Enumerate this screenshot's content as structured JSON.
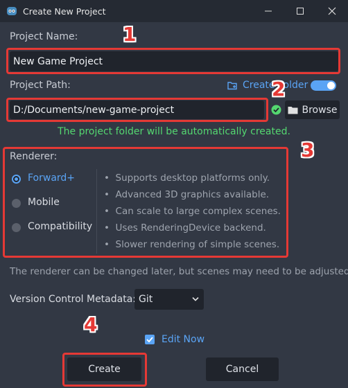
{
  "window": {
    "title": "Create New Project"
  },
  "project_name": {
    "label": "Project Name:",
    "value": "New Game Project"
  },
  "project_path": {
    "label": "Project Path:",
    "value": "D:/Documents/new-game-project",
    "create_folder_label": "Create Folder",
    "create_folder_on": true,
    "browse_label": "Browse",
    "status_message": "The project folder will be automatically created."
  },
  "renderer": {
    "label": "Renderer:",
    "options": [
      {
        "label": "Forward+",
        "selected": true
      },
      {
        "label": "Mobile",
        "selected": false
      },
      {
        "label": "Compatibility",
        "selected": false
      }
    ],
    "features": [
      "Supports desktop platforms only.",
      "Advanced 3D graphics available.",
      "Can scale to large complex scenes.",
      "Uses RenderingDevice backend.",
      "Slower rendering of simple scenes."
    ],
    "note": "The renderer can be changed later, but scenes may need to be adjusted."
  },
  "version_control": {
    "label": "Version Control Metadata:",
    "value": "Git"
  },
  "edit_now": {
    "label": "Edit Now",
    "checked": true
  },
  "buttons": {
    "create": "Create",
    "cancel": "Cancel"
  },
  "annotations": [
    "1",
    "2",
    "3",
    "4"
  ],
  "colors": {
    "accent": "#5aa4f5",
    "success": "#54d770",
    "highlight": "#e53935"
  }
}
